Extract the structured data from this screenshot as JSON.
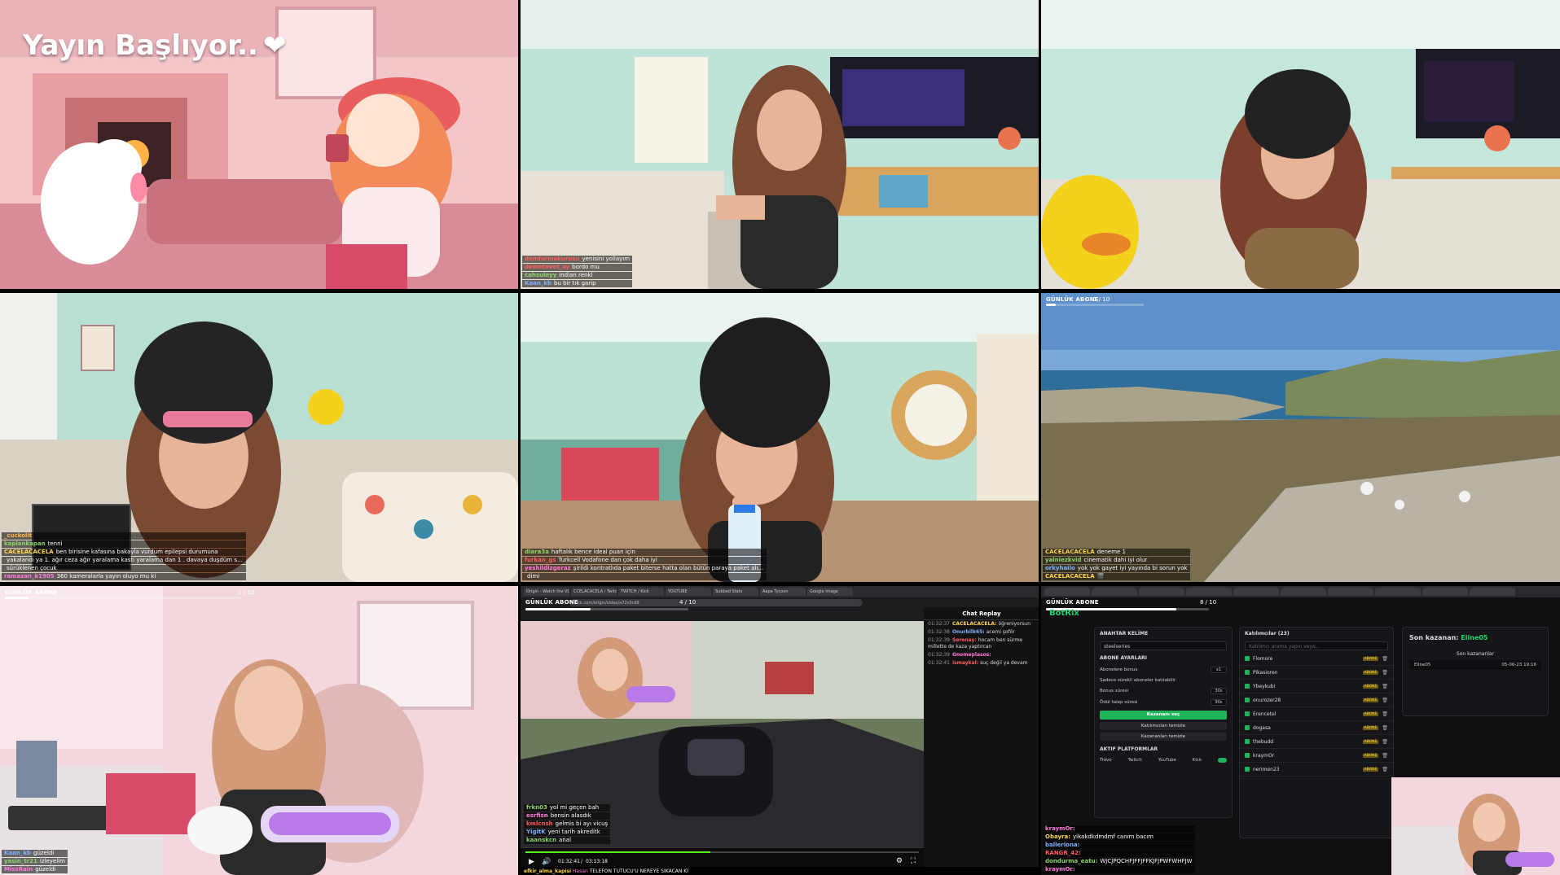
{
  "tile1": {
    "title": "Yayın Başlıyor..",
    "heart": "❤"
  },
  "tile2": {
    "chat": [
      {
        "user": "dondurmakurusu",
        "msg": "yenisini yollayım",
        "color": "#ff5c5c"
      },
      {
        "user": "demetevet_ay",
        "msg": "bordo mu",
        "color": "#ff5c5c"
      },
      {
        "user": "cahsuleyy",
        "msg": "indian renkl",
        "color": "#8bd36a"
      },
      {
        "user": "Kaan_kb",
        "msg": "bu bir tık garip",
        "color": "#7fb3ff"
      }
    ]
  },
  "tile4": {
    "chat": [
      {
        "user": "_cuckolit",
        "msg": "",
        "color": "#ffb347"
      },
      {
        "user": "kaplankapan",
        "msg": "tenni",
        "color": "#8bd36a"
      },
      {
        "user": "CACELACACELA",
        "msg": "ben birisine kafasına bakayla vurdum epilepsi durumuna",
        "color": "#ffd54a"
      },
      {
        "user": "",
        "msg": "yakalandı ya 1. ağır ceza ağır yaralama kasti yaralama dan 1 . davaya duşdüm suça",
        "color": "#ffffff"
      },
      {
        "user": "",
        "msg": "sürüklenen çocuk",
        "color": "#ffffff"
      },
      {
        "user": "ramazan_k1905",
        "msg": "360 kameralarla yayın oluyo mu ki",
        "color": "#ff7ad9"
      }
    ]
  },
  "tile5": {
    "chat": [
      {
        "user": "diara3a",
        "msg": "haftalık bence ideal puan için",
        "color": "#8bd36a"
      },
      {
        "user": "furkan_gs",
        "msg": "Turkcell Vodafone dan çok daha iyi",
        "color": "#ff5c5c"
      },
      {
        "user": "yeshildizgeraz",
        "msg": "şirildi kontratlıda paket biterse hatta olan bütün paraya paket alıyo",
        "color": "#ff7ad9"
      },
      {
        "user": "",
        "msg": "dimi",
        "color": "#ffffff"
      }
    ]
  },
  "tile6": {
    "sub_label": "GÜNLÜK ABONE",
    "sub_count": "1 / 10",
    "sub_progress": 0.1,
    "chat": [
      {
        "user": "CACELACACELA",
        "msg": "deneme 1",
        "color": "#ffd54a"
      },
      {
        "user": "yalniezkvid",
        "msg": "cinematik dahi iyi olur",
        "color": "#8bd36a"
      },
      {
        "user": "orkyhailo",
        "msg": "yok yok gayet iyi yayında bi sorun yok",
        "color": "#7fb3ff"
      },
      {
        "user": "CACELACACELA",
        "msg": "🎬",
        "color": "#ffd54a"
      }
    ]
  },
  "tile7": {
    "sub_label": "GÜNLÜK ABONE",
    "sub_count": "1 / 10",
    "sub_progress": 0.1,
    "chat": [
      {
        "user": "Kaan_kb",
        "msg": "güzeldi",
        "color": "#7fb3ff"
      },
      {
        "user": "yasin_tr21",
        "msg": "izleyelim",
        "color": "#8bd36a"
      },
      {
        "user": "MissRain",
        "msg": "güzeldi",
        "color": "#ff7ad9"
      }
    ]
  },
  "tile8": {
    "sub_label": "GÜNLÜK ABONE",
    "sub_count": "4 / 10",
    "sub_progress": 0.4,
    "tabs": [
      "Origin - Watch the VOD",
      "CCELACACELA / Twitch",
      "TWITCH / Kick",
      "YOUTUBE",
      "Subbed Stats",
      "Aapa Tycoon",
      "Google Image"
    ],
    "url": "kick.com/origin/video/a72c0cd9",
    "chat_title": "Chat Replay",
    "chat": [
      {
        "time": "01:32:37",
        "user": "CACELACACELA:",
        "msg": "öğreniyorsun",
        "color": "#ffd54a"
      },
      {
        "time": "01:32:38",
        "user": "Onurbilk65:",
        "msg": "acemi şoför",
        "color": "#7fb3ff"
      },
      {
        "time": "01:32:39",
        "user": "Serenay:",
        "msg": "hocam ben sürme millette de kaza yaptırcan",
        "color": "#ff5c5c"
      },
      {
        "time": "01:32:39",
        "user": "Gnomeplasos:",
        "msg": "",
        "color": "#ff7ad9"
      },
      {
        "time": "01:32:41",
        "user": "ismaykal:",
        "msg": "suç değil ya devam",
        "color": "#ff5c5c"
      }
    ],
    "video_chat": [
      {
        "user": "frkn03",
        "msg": "yol mi geçen bah",
        "color": "#8bd36a"
      },
      {
        "user": "esrfisn",
        "msg": "bensin alasdık",
        "color": "#ff7ad9"
      },
      {
        "user": "kmlcnsh",
        "msg": "gelmis bi ayı vicuş",
        "color": "#ff5c5c"
      },
      {
        "user": "YigitK",
        "msg": "yeni tarih akreditk",
        "color": "#7fb3ff"
      },
      {
        "user": "kaanskcn",
        "msg": "anal",
        "color": "#8bd36a"
      }
    ],
    "time_current": "01:32:41",
    "time_total": "03:13:18",
    "ticker_user": "efkir_alma_kapisi",
    "ticker_from": "Hasan",
    "ticker_msg": "TELEFON TUTUCU'U NEREYE SIKACAN Kİ"
  },
  "tile9": {
    "sub_label": "GÜNLÜK ABONE",
    "sub_count": "8 / 10",
    "sub_progress": 0.8,
    "logo": "BotRix",
    "key_title": "ANAHTAR KELİME",
    "key_value": "steelseries",
    "abone_title": "ABONE AYARLARI",
    "abone_bonus": "Abonelere bonus",
    "abone_bonus_sel": "x1",
    "auto_sub": "Sadece sürekli aboneler katılabilir",
    "bonus_sure": "Bonus süresi",
    "bonus_sure_sel": "30s",
    "odul_sure": "Ödül talep süresi",
    "odul_sure_sel": "90s",
    "btn_start": "Kazananı seç",
    "btn_clear": "Katılımcıları temizle",
    "btn_winners": "Kazananları temizle",
    "platform_title": "AKTIF PLATFORMLAR",
    "platforms": [
      "Trovo",
      "Twitch",
      "YouTube",
      "Kick"
    ],
    "participants_title": "Katılımcılar (23)",
    "participants_search": "Katılımcı arama yapın veya...",
    "participants": [
      "Flomore",
      "Pikasioren",
      "Ybeykubi",
      "onurozer28",
      "Erencetel",
      "dogasa",
      "thebudd",
      "kraymOr",
      "nerimen23"
    ],
    "badge": "ABONE",
    "last_winner_label": "Son kazanan:",
    "last_winner": "Eline05",
    "winners_title": "Son kazananlar",
    "winners": [
      {
        "name": "Eline05",
        "date": "05-06-23 19:16"
      }
    ],
    "chat": [
      {
        "user": "kraymOr:",
        "msg": "",
        "color": "#ff7ad9"
      },
      {
        "user": "Obayra:",
        "msg": "yikakdkdmdmf canım bacım",
        "color": "#ffd54a"
      },
      {
        "user": "balleriona:",
        "msg": "",
        "color": "#7fb3ff"
      },
      {
        "user": "RANGR_42:",
        "msg": "",
        "color": "#ff5c5c"
      },
      {
        "user": "dondurma_eatu:",
        "msg": "WJCJPQCHFJFFJFFKJFJPWFWHFJW",
        "color": "#8bd36a"
      },
      {
        "user": "kraymOr:",
        "msg": "",
        "color": "#ff7ad9"
      }
    ]
  }
}
